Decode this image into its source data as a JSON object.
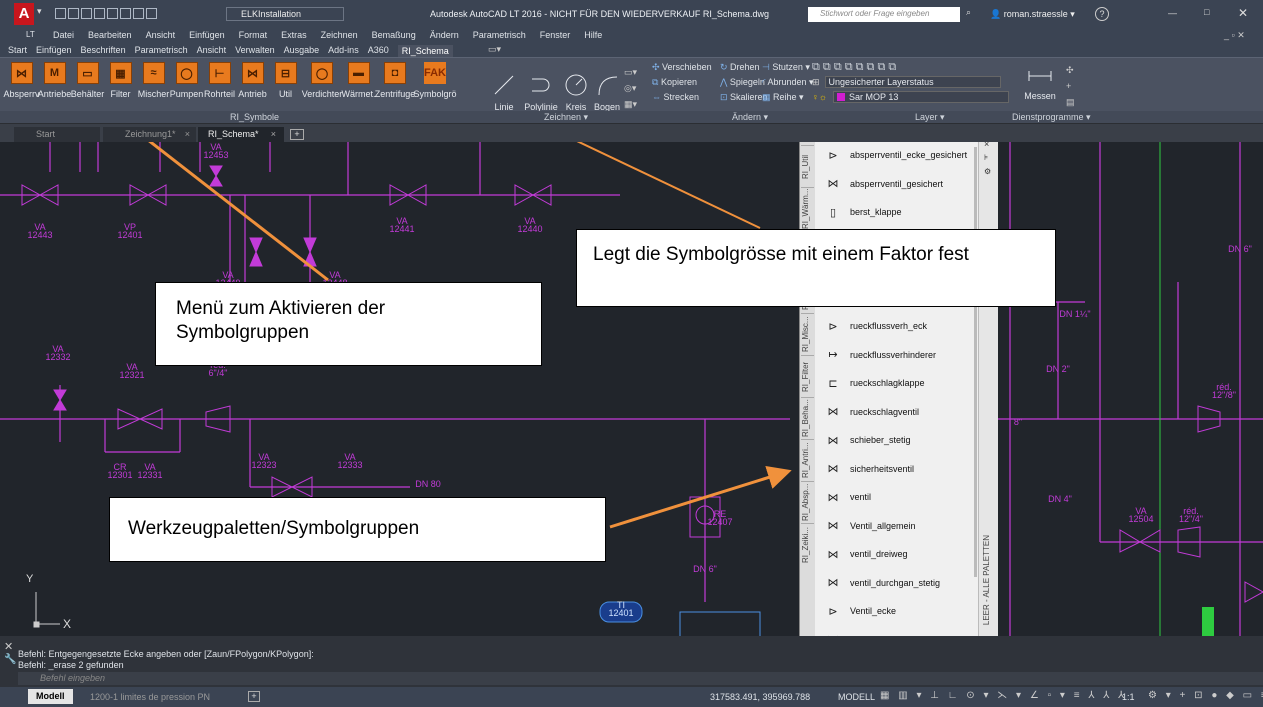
{
  "app": {
    "title": "Autodesk AutoCAD LT 2016 - NICHT FÜR DEN WIEDERVERKAUF   RI_Schema.dwg",
    "workspace": "ELKInstallation",
    "search_placeholder": "Stichwort oder Frage eingeben",
    "user": "roman.straessle",
    "version_badge": "LT"
  },
  "menu": [
    "Datei",
    "Bearbeiten",
    "Ansicht",
    "Einfügen",
    "Format",
    "Extras",
    "Zeichnen",
    "Bemaßung",
    "Ändern",
    "Parametrisch",
    "Fenster",
    "Hilfe"
  ],
  "tabs": [
    "Start",
    "Einfügen",
    "Beschriften",
    "Parametrisch",
    "Ansicht",
    "Verwalten",
    "Ausgabe",
    "Add-ins",
    "A360",
    "RI_Schema"
  ],
  "ribbon": {
    "symbols": [
      {
        "label": "Absperrv",
        "glyph": "⋈"
      },
      {
        "label": "Antriebe",
        "glyph": "M"
      },
      {
        "label": "Behälter",
        "glyph": "▭"
      },
      {
        "label": "Filter",
        "glyph": "▦"
      },
      {
        "label": "Mischer",
        "glyph": "≈"
      },
      {
        "label": "Pumpen",
        "glyph": "◯"
      },
      {
        "label": "Rohrteil",
        "glyph": "⊢"
      },
      {
        "label": "Antrieb",
        "glyph": "⋈"
      },
      {
        "label": "Util",
        "glyph": "⊟"
      },
      {
        "label": "Verdichter",
        "glyph": "◯"
      },
      {
        "label": "Wärmet.",
        "glyph": "▬"
      },
      {
        "label": "Zentrifuge",
        "glyph": "◘"
      },
      {
        "label": "Symbolgrö",
        "glyph": "FAK"
      }
    ],
    "panel_symbols": "RI_Symbole",
    "draw": [
      "Linie",
      "Polylinie",
      "Kreis",
      "Bogen"
    ],
    "panel_draw": "Zeichnen ▾",
    "modify": [
      [
        "Verschieben",
        "Drehen",
        "Stutzen ▾"
      ],
      [
        "Kopieren",
        "Spiegeln",
        "Abrunden ▾"
      ],
      [
        "Strecken",
        "Skalieren",
        "Reihe ▾"
      ]
    ],
    "panel_modify": "Ändern ▾",
    "layer_status": "Ungesicherter Layerstatus",
    "layer_name": "Sar MOP 13",
    "panel_layer": "Layer ▾",
    "measure": "Messen",
    "panel_util": "Dienstprogramme ▾"
  },
  "doctabs": [
    "Start",
    "Zeichnung1*",
    "RI_Schema*"
  ],
  "palette": {
    "title": "LEER - ALLE PALETTEN",
    "side_tabs": [
      "RI_Util",
      "RI_Wärm...",
      "RI_Rohr",
      "RI_Pum...",
      "RI_Misc...",
      "RI_Filter",
      "RI_Beha...",
      "RI_Antri...",
      "RI_Absp...",
      "RI_Zeiki..."
    ],
    "items": [
      {
        "label": "absperrventil_ecke_gesichert",
        "icon": "⊳"
      },
      {
        "label": "absperrventil_gesichert",
        "icon": "⋈"
      },
      {
        "label": "berst_klappe",
        "icon": "▯"
      },
      {
        "label": "",
        "icon": ""
      },
      {
        "label": "",
        "icon": ""
      },
      {
        "label": "",
        "icon": ""
      },
      {
        "label": "rueckflussverh_eck",
        "icon": "⊳"
      },
      {
        "label": "rueckflussverhinderer",
        "icon": "↦"
      },
      {
        "label": "rueckschlagklappe",
        "icon": "⊏"
      },
      {
        "label": "rueckschlagventil",
        "icon": "⋈"
      },
      {
        "label": "schieber_stetig",
        "icon": "⋈"
      },
      {
        "label": "sicherheitsventil",
        "icon": "⋈"
      },
      {
        "label": "ventil",
        "icon": "⋈"
      },
      {
        "label": "Ventil_allgemein",
        "icon": "⋈"
      },
      {
        "label": "ventil_dreiweg",
        "icon": "⋈"
      },
      {
        "label": "ventil_durchgan_stetig",
        "icon": "⋈"
      },
      {
        "label": "Ventil_ecke",
        "icon": "⊳"
      },
      {
        "label": "",
        "icon": "⋈"
      }
    ]
  },
  "callouts": {
    "menu": "Menü zum Aktivieren der Symbolgruppen",
    "size": "Legt die Symbolgrösse mit einem Faktor fest",
    "palettes": "Werkzeugpaletten/Symbolgruppen"
  },
  "drawing": {
    "tags": [
      "VA",
      "12453",
      "VA",
      "12443",
      "VP",
      "12401",
      "VA",
      "12441",
      "VA",
      "12440",
      "VA",
      "12449",
      "VA",
      "12448",
      "VA",
      "12332",
      "VA",
      "12321",
      "réd.",
      "6\"/4\"",
      "CR",
      "12301",
      "VA",
      "12331",
      "VA",
      "12323",
      "VA",
      "12333",
      "DN 80",
      "DN 6\"",
      "RE",
      "12407",
      "TI",
      "12401",
      "DN 6\"",
      "VA",
      "12504",
      "réd.",
      "12\"/4\"",
      "réd.",
      "12\"/8\"",
      "8\"",
      "DN 1¼\"",
      "DN 2\"",
      "DN 4\"",
      "VA",
      "DN 6\""
    ]
  },
  "ucs": {
    "x": "X",
    "y": "Y"
  },
  "cmd": {
    "line1": "Befehl: Entgegengesetzte Ecke angeben oder [Zaun/FPolygon/KPolygon]:",
    "line2": "Befehl: _erase 2 gefunden",
    "placeholder": "Befehl eingeben"
  },
  "layout_tabs": [
    "Modell",
    "1200-1 limites de pression PN"
  ],
  "status": {
    "coords": "317583.491, 395969.788",
    "mode": "MODELL",
    "scale": "1:1"
  }
}
